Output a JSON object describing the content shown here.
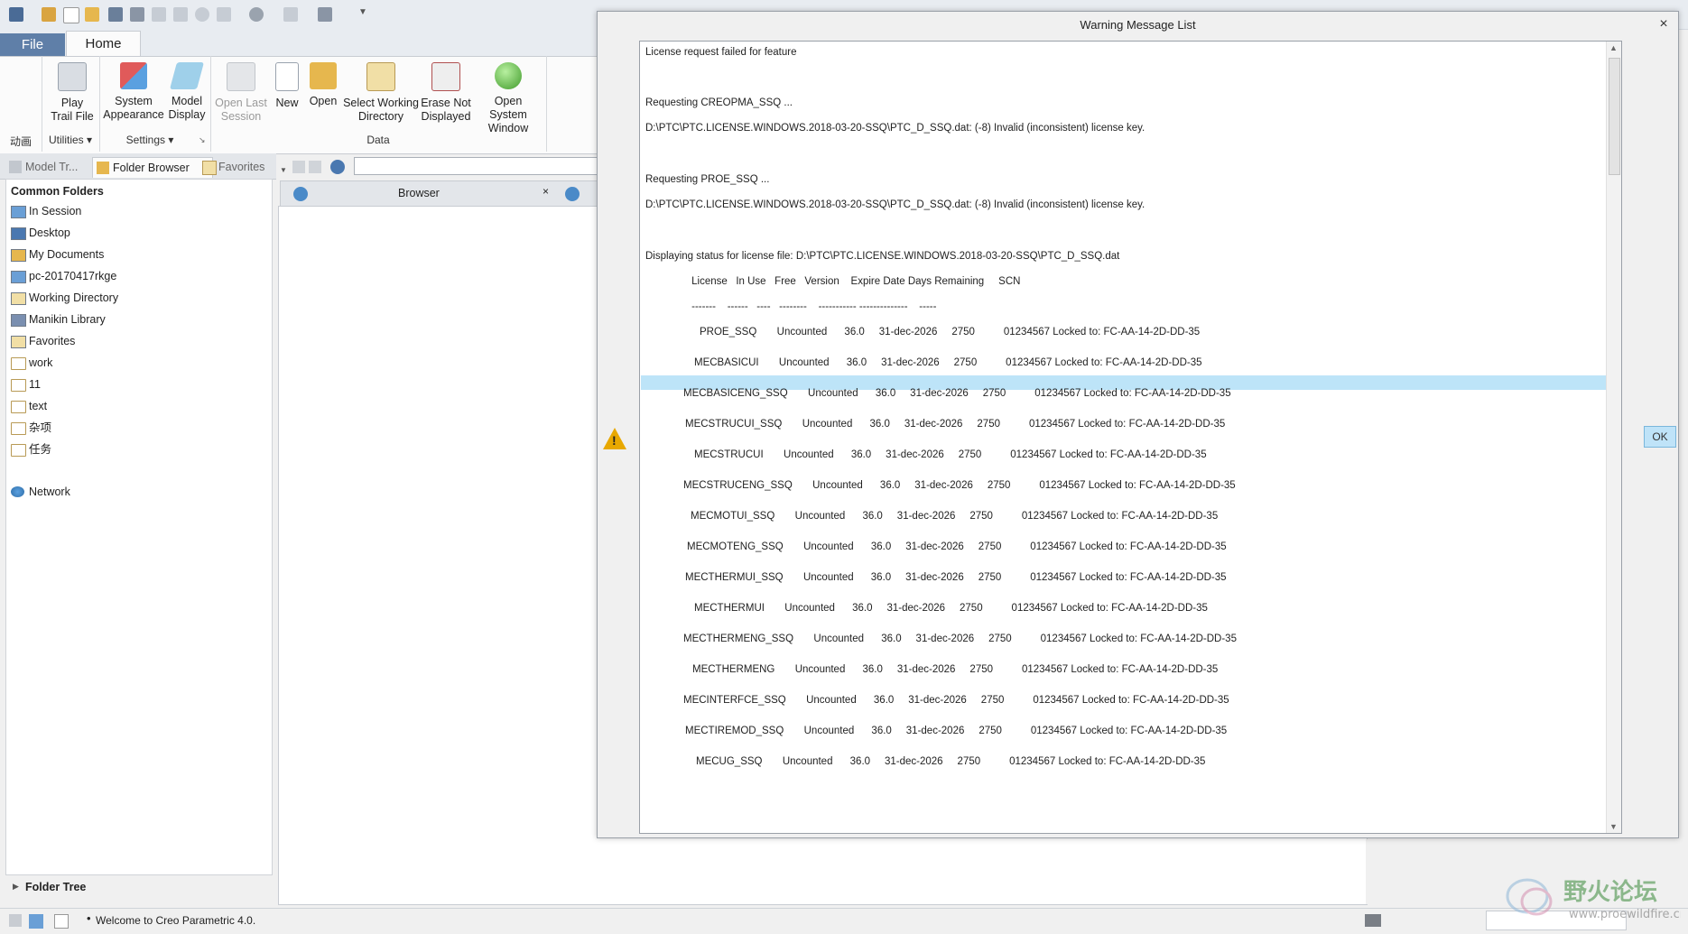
{
  "ribbon": {
    "tabs": {
      "file": "File",
      "home": "Home"
    },
    "buttons": {
      "play_trail": [
        "Play",
        "Trail File"
      ],
      "system_appearance": [
        "System",
        "Appearance"
      ],
      "model_display": [
        "Model",
        "Display"
      ],
      "open_last_session": [
        "Open Last",
        "Session"
      ],
      "new": "New",
      "open": "Open",
      "select_working_dir": [
        "Select Working",
        "Directory"
      ],
      "erase_not_displayed": [
        "Erase Not",
        "Displayed"
      ],
      "open_system_window": [
        "Open System",
        "Window"
      ]
    },
    "groups": {
      "animation": "动画",
      "utilities": "Utilities ▾",
      "settings": "Settings ▾",
      "data": "Data"
    }
  },
  "navigator": {
    "tabs": {
      "model_tree": "Model Tr...",
      "folder_browser": "Folder Browser",
      "favorites": "Favorites"
    },
    "section_title": "Common Folders",
    "folders": [
      "In Session",
      "Desktop",
      "My Documents",
      "pc-20170417rkge",
      "Working Directory",
      "Manikin Library",
      "Favorites",
      "work",
      "11",
      "text",
      "杂项",
      "任务"
    ],
    "network": "Network",
    "folder_tree": "Folder Tree"
  },
  "browser": {
    "tab_label": "Browser",
    "address_value": ""
  },
  "status": {
    "message": "Welcome to Creo Parametric 4.0."
  },
  "dialog": {
    "title": "Warning Message List",
    "ok_label": "OK",
    "header_lines": [
      "License request failed for feature",
      "Requesting CREOPMA_SSQ ...",
      "D:\\PTC\\PTC.LICENSE.WINDOWS.2018-03-20-SSQ\\PTC_D_SSQ.dat: (-8) Invalid (inconsistent) license key.",
      "Requesting PROE_SSQ ...",
      "D:\\PTC\\PTC.LICENSE.WINDOWS.2018-03-20-SSQ\\PTC_D_SSQ.dat: (-8) Invalid (inconsistent) license key.",
      "Displaying status for license file: D:\\PTC\\PTC.LICENSE.WINDOWS.2018-03-20-SSQ\\PTC_D_SSQ.dat",
      "                License   In Use   Free   Version    Expire Date Days Remaining     SCN",
      "                -------    ------   ----   --------    ----------- --------------    -----"
    ],
    "license_rows": [
      "PROE_SSQ       Uncounted      36.0     31-dec-2026     2750          01234567 Locked to: FC-AA-14-2D-DD-35",
      "MECBASICUI       Uncounted      36.0     31-dec-2026     2750          01234567 Locked to: FC-AA-14-2D-DD-35",
      "MECBASICENG_SSQ       Uncounted      36.0     31-dec-2026     2750          01234567 Locked to: FC-AA-14-2D-DD-35",
      "MECSTRUCUI_SSQ       Uncounted      36.0     31-dec-2026     2750          01234567 Locked to: FC-AA-14-2D-DD-35",
      "MECSTRUCUI       Uncounted      36.0     31-dec-2026     2750          01234567 Locked to: FC-AA-14-2D-DD-35",
      "MECSTRUCENG_SSQ       Uncounted      36.0     31-dec-2026     2750          01234567 Locked to: FC-AA-14-2D-DD-35",
      "MECMOTUI_SSQ       Uncounted      36.0     31-dec-2026     2750          01234567 Locked to: FC-AA-14-2D-DD-35",
      "MECMOTENG_SSQ       Uncounted      36.0     31-dec-2026     2750          01234567 Locked to: FC-AA-14-2D-DD-35",
      "MECTHERMUI_SSQ       Uncounted      36.0     31-dec-2026     2750          01234567 Locked to: FC-AA-14-2D-DD-35",
      "MECTHERMUI       Uncounted      36.0     31-dec-2026     2750          01234567 Locked to: FC-AA-14-2D-DD-35",
      "MECTHERMENG_SSQ       Uncounted      36.0     31-dec-2026     2750          01234567 Locked to: FC-AA-14-2D-DD-35",
      "MECTHERMENG       Uncounted      36.0     31-dec-2026     2750          01234567 Locked to: FC-AA-14-2D-DD-35",
      "MECINTERFCE_SSQ       Uncounted      36.0     31-dec-2026     2750          01234567 Locked to: FC-AA-14-2D-DD-35",
      "MECTIREMOD_SSQ       Uncounted      36.0     31-dec-2026     2750          01234567 Locked to: FC-AA-14-2D-DD-35",
      "MECUG_SSQ       Uncounted      36.0     31-dec-2026     2750          01234567 Locked to: FC-AA-14-2D-DD-35"
    ]
  },
  "watermark": {
    "text": "野火论坛",
    "url": "www.proewildfire.cn"
  },
  "colors": {
    "file_tab": "#5f7fa8",
    "highlight": "#bde4f8",
    "ok_button": "#bfe3f8",
    "warning": "#e8a800"
  }
}
